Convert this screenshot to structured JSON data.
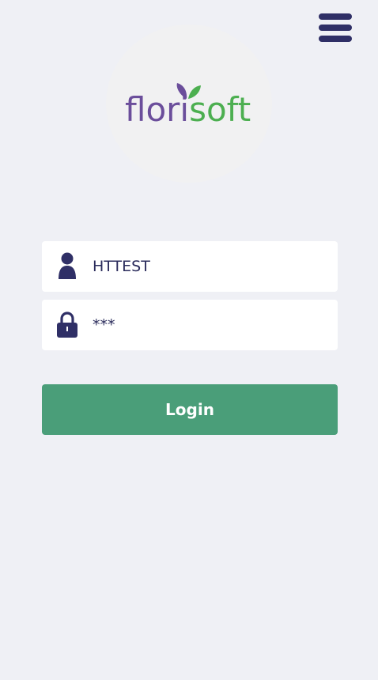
{
  "header": {
    "menu_icon": "hamburger-menu-icon"
  },
  "logo": {
    "text_left": "flor",
    "text_i": "i",
    "text_right": "soft",
    "icon": "leaf-icon"
  },
  "login_form": {
    "username": {
      "icon": "user-icon",
      "value": "HTTEST"
    },
    "password": {
      "icon": "lock-icon",
      "value": "***"
    },
    "submit_label": "Login"
  },
  "colors": {
    "background": "#eff0f5",
    "accent_navy": "#2f2f66",
    "brand_purple": "#6b4e9b",
    "brand_green": "#4caf50",
    "button_green": "#4a9e79",
    "field_background": "#ffffff"
  }
}
